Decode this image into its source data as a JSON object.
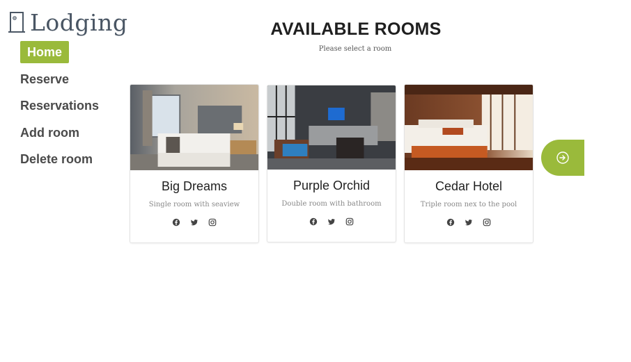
{
  "brand": {
    "name": "Lodging"
  },
  "nav": {
    "items": [
      {
        "label": "Home",
        "active": true
      },
      {
        "label": "Reserve",
        "active": false
      },
      {
        "label": "Reservations",
        "active": false
      },
      {
        "label": "Add room",
        "active": false
      },
      {
        "label": "Delete room",
        "active": false
      }
    ]
  },
  "main": {
    "title": "AVAILABLE ROOMS",
    "subtitle": "Please select a room"
  },
  "rooms": [
    {
      "name": "Big Dreams",
      "description": "Single room with seaview",
      "social": [
        "facebook-icon",
        "twitter-icon",
        "instagram-icon"
      ]
    },
    {
      "name": "Purple Orchid",
      "description": "Double room with bathroom",
      "social": [
        "facebook-icon",
        "twitter-icon",
        "instagram-icon"
      ]
    },
    {
      "name": "Cedar Hotel",
      "description": "Triple room nex to the pool",
      "social": [
        "facebook-icon",
        "twitter-icon",
        "instagram-icon"
      ]
    }
  ],
  "controls": {
    "next_icon": "arrow-right-circle-icon"
  },
  "colors": {
    "accent": "#9aba3b",
    "nav_text": "#4a4a4a",
    "logo": "#4a5664"
  }
}
